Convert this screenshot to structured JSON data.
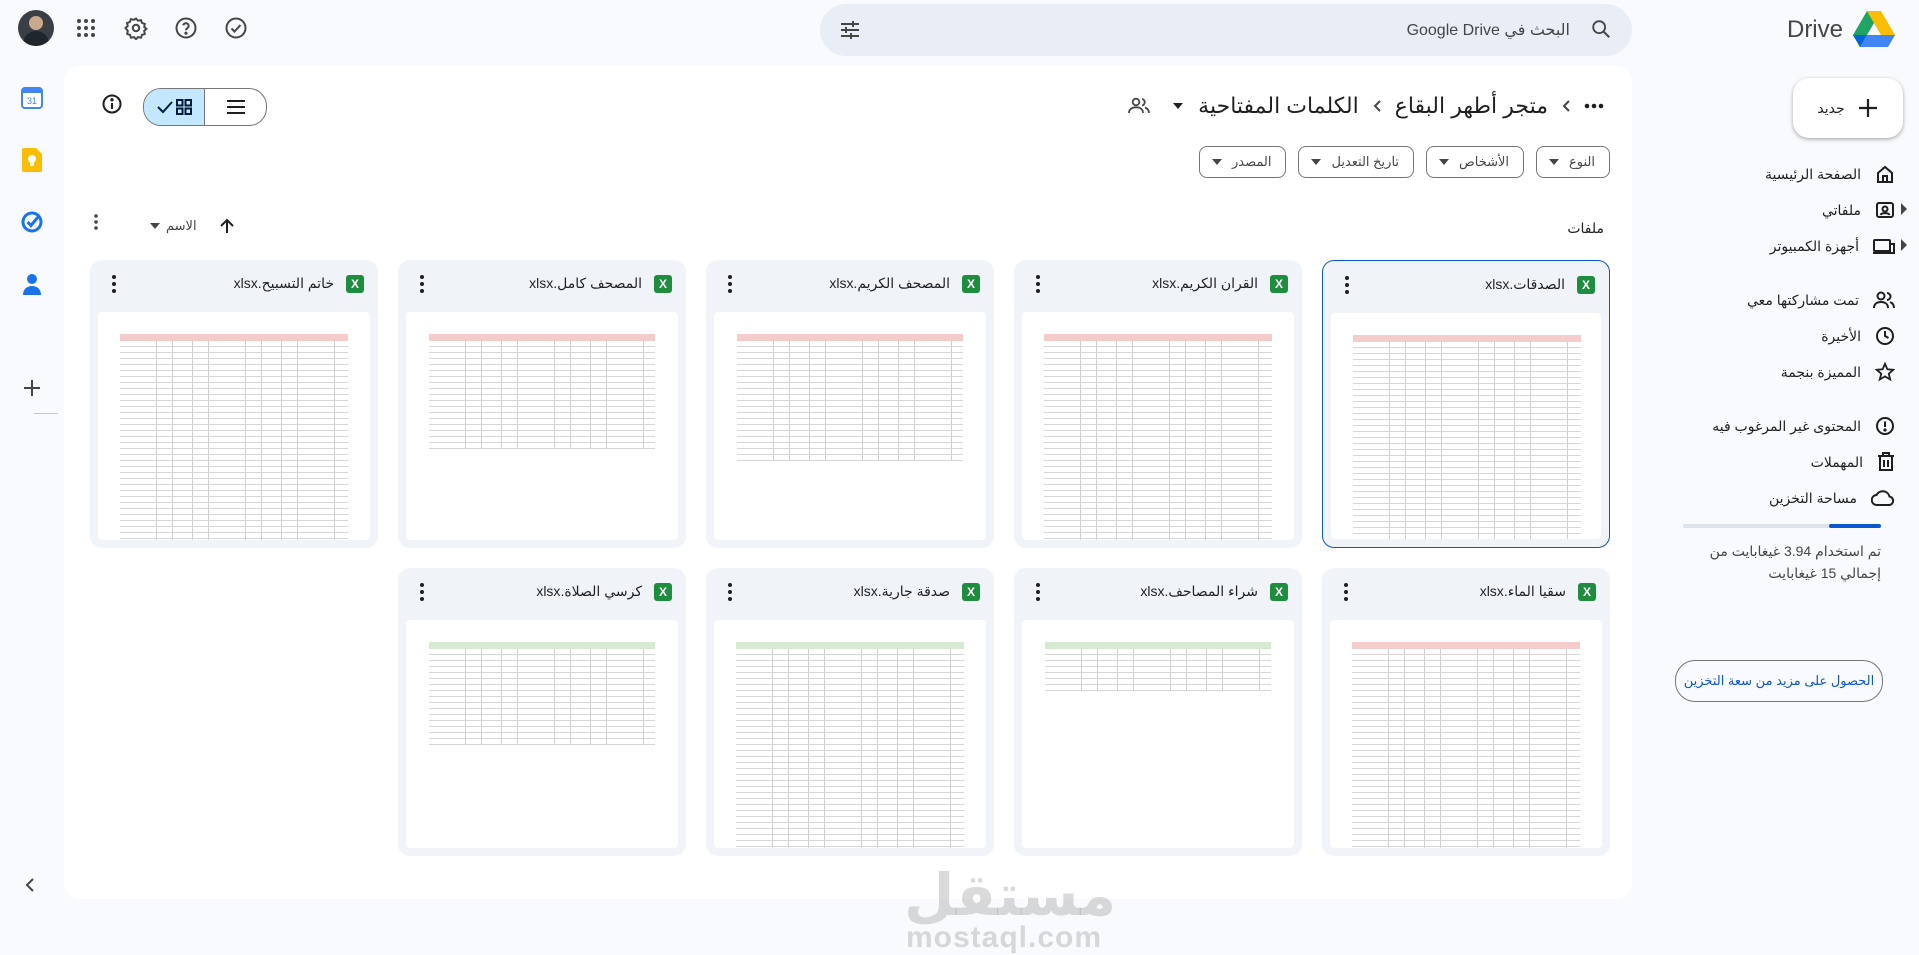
{
  "app": {
    "name": "Drive"
  },
  "search": {
    "placeholder": "البحث في Google Drive"
  },
  "nav": {
    "new_label": "جديد",
    "items": [
      {
        "label": "الصفحة الرئيسية",
        "icon": "home-icon"
      },
      {
        "label": "ملفاتي",
        "icon": "my-drive-icon"
      },
      {
        "label": "أجهزة الكمبيوتر",
        "icon": "computers-icon"
      },
      {
        "label": "تمت مشاركتها معي",
        "icon": "shared-icon"
      },
      {
        "label": "الأخيرة",
        "icon": "clock-icon"
      },
      {
        "label": "المميزة بنجمة",
        "icon": "star-icon"
      },
      {
        "label": "المحتوى غير المرغوب فيه",
        "icon": "spam-icon"
      },
      {
        "label": "المهملات",
        "icon": "trash-icon"
      },
      {
        "label": "مساحة التخزين",
        "icon": "cloud-icon"
      }
    ],
    "storage": {
      "used_fraction": 0.263,
      "text": "تم استخدام 3.94 غيغابايت من إجمالي 15 غيغابايت",
      "button": "الحصول على مزيد من سعة التخزين"
    }
  },
  "breadcrumb": {
    "items": [
      "متجر أطهر البقاع",
      "الكلمات المفتاحية"
    ]
  },
  "filters": [
    "النوع",
    "الأشخاص",
    "تاريخ التعديل",
    "المصدر"
  ],
  "files_section": {
    "label": "ملفات",
    "sort_label": "الاسم"
  },
  "files": [
    {
      "name": "الصدقات.xlsx",
      "header_color": "#f4cccc",
      "rows": 34
    },
    {
      "name": "القران الكريم.xlsx",
      "header_color": "#f4cccc",
      "rows": 34
    },
    {
      "name": "المصحف الكريم.xlsx",
      "header_color": "#f4cccc",
      "rows": 20
    },
    {
      "name": "المصحف كامل.xlsx",
      "header_color": "#f4cccc",
      "rows": 18
    },
    {
      "name": "خاتم التسبيح.xlsx",
      "header_color": "#f4cccc",
      "rows": 34
    },
    {
      "name": "سقيا الماء.xlsx",
      "header_color": "#f4cccc",
      "rows": 34
    },
    {
      "name": "شراء المصاحف.xlsx",
      "header_color": "#d9ead3",
      "rows": 7
    },
    {
      "name": "صدقة جارية.xlsx",
      "header_color": "#d9ead3",
      "rows": 34
    },
    {
      "name": "كرسي الصلاة.xlsx",
      "header_color": "#d9ead3",
      "rows": 16
    }
  ],
  "watermark": {
    "ar": "مستقل",
    "en": "mostaql.com"
  }
}
